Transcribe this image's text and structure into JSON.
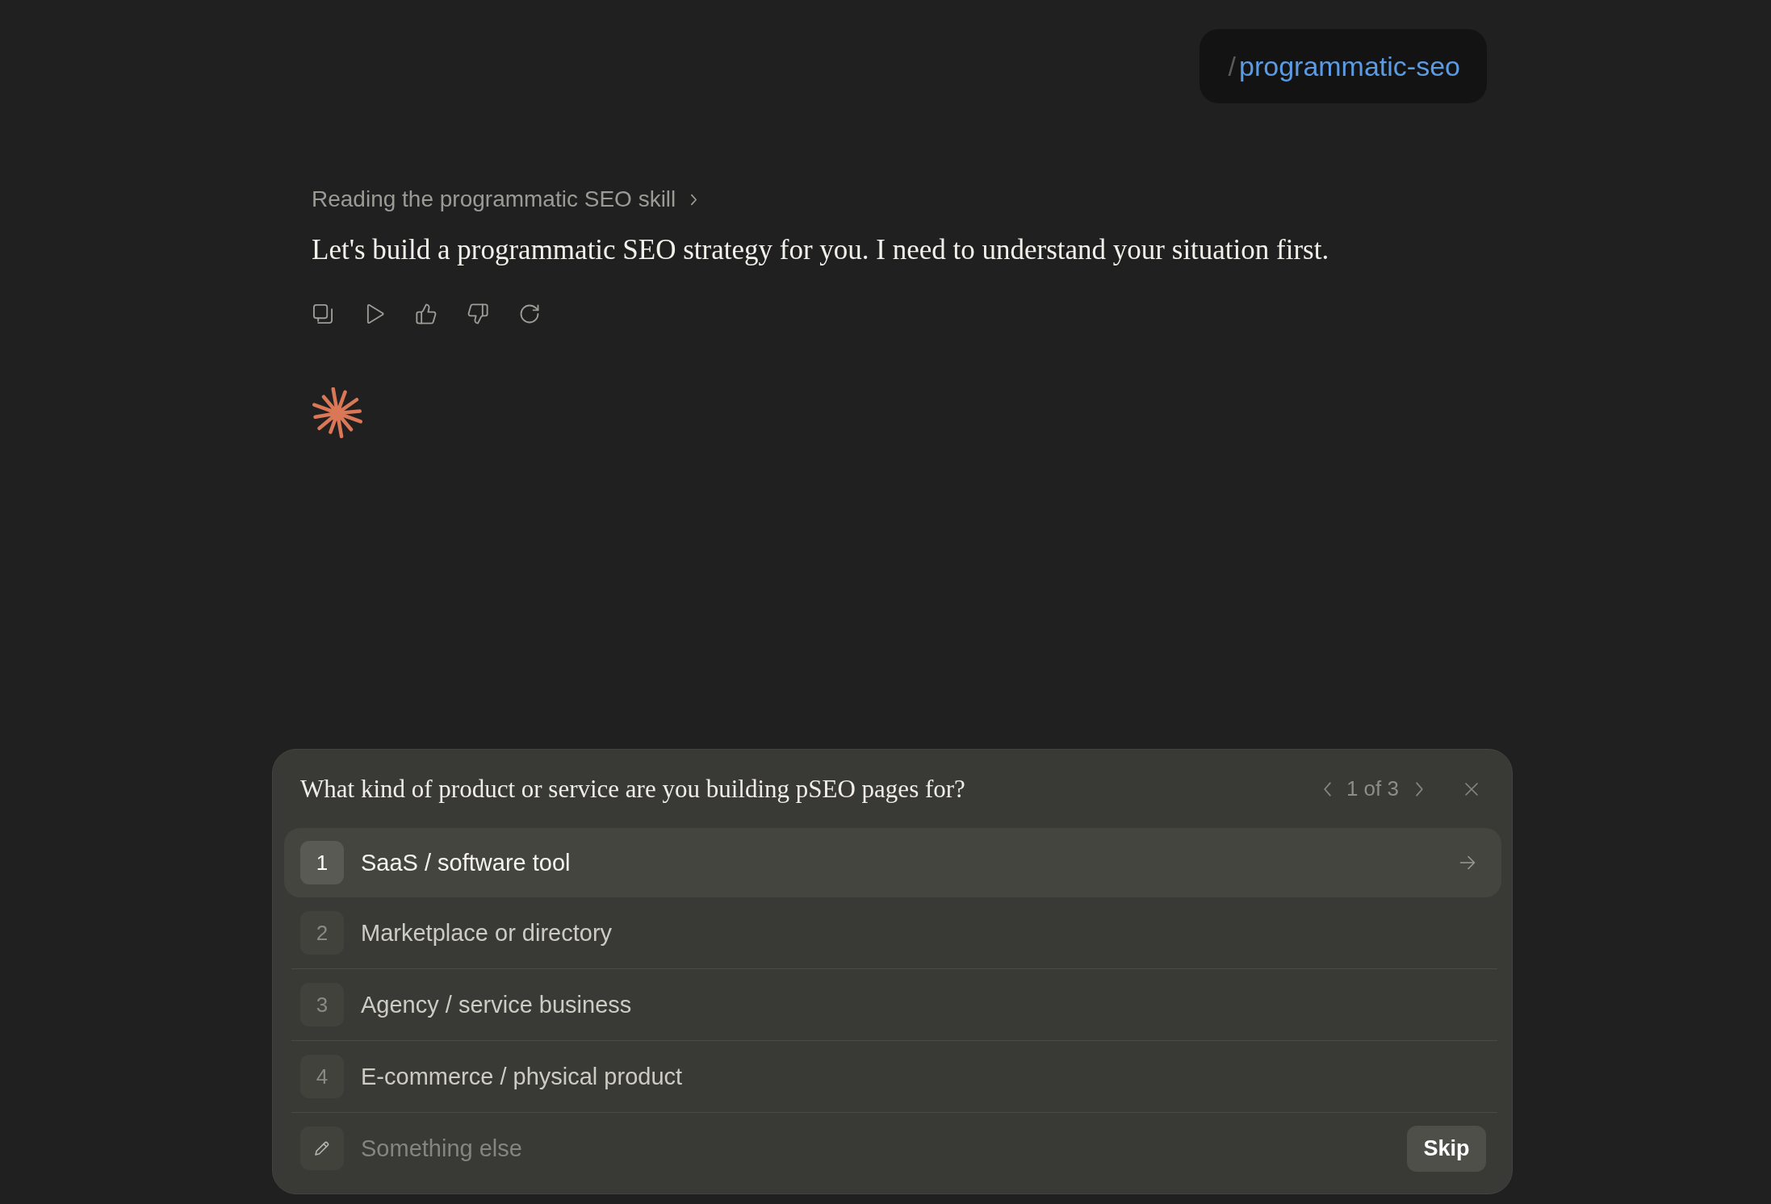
{
  "user_message": {
    "slash": "/",
    "command": "programmatic-seo"
  },
  "assistant": {
    "status": "Reading the programmatic SEO skill",
    "message": "Let's build a programmatic SEO strategy for you. I need to understand your situation first."
  },
  "question": {
    "prompt": "What kind of product or service are you building pSEO pages for?",
    "pager": "1 of 3",
    "options": [
      {
        "number": "1",
        "label": "SaaS / software tool",
        "selected": true
      },
      {
        "number": "2",
        "label": "Marketplace or directory",
        "selected": false
      },
      {
        "number": "3",
        "label": "Agency / service business",
        "selected": false
      },
      {
        "number": "4",
        "label": "E-commerce / physical product",
        "selected": false
      }
    ],
    "other": {
      "placeholder": "Something else"
    },
    "skip": "Skip"
  }
}
